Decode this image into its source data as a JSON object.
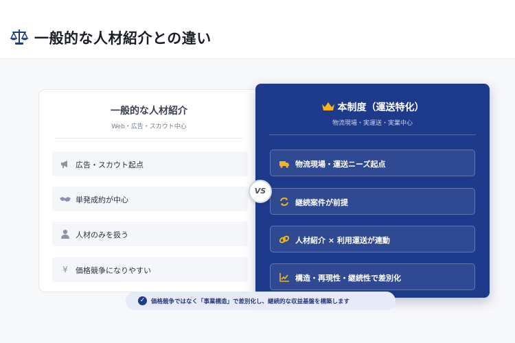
{
  "header": {
    "title": "一般的な人材紹介との違い",
    "icon": "scale-icon"
  },
  "left_card": {
    "title": "一般的な人材紹介",
    "subtitle": "Web・広告・スカウト中心",
    "items": [
      {
        "icon": "megaphone-icon",
        "label": "広告・スカウト起点"
      },
      {
        "icon": "handshake-icon",
        "label": "単発成約が中心"
      },
      {
        "icon": "person-icon",
        "label": "人材のみを扱う"
      },
      {
        "icon": "yen-icon",
        "label": "価格競争になりやすい"
      }
    ]
  },
  "vs_label": "VS",
  "right_card": {
    "title": "本制度（運送特化）",
    "subtitle": "物流現場・実運送・実業中心",
    "icon": "crown-icon",
    "items": [
      {
        "icon": "truck-icon",
        "label": "物流現場・運送ニーズ起点"
      },
      {
        "icon": "sync-icon",
        "label": "継続案件が前提"
      },
      {
        "icon": "link-icon",
        "label": "人材紹介 × 利用運送が連動"
      },
      {
        "icon": "chart-line-icon",
        "label": "構造・再現性・継続性で差別化"
      }
    ]
  },
  "banner": {
    "icon": "check-circle-icon",
    "text": "価格競争ではなく「事業構造」で差別化し、継続的な収益基盤を構築します"
  },
  "colors": {
    "primary": "#1e3a8a",
    "accent_gold": "#f5b417",
    "page_bg": "#f7f8fa"
  }
}
